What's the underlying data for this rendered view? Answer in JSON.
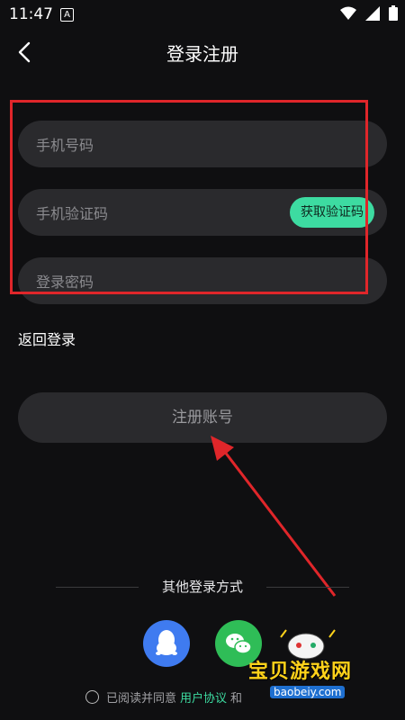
{
  "status_bar": {
    "time": "11:47",
    "notif_letter": "A"
  },
  "header": {
    "title": "登录注册"
  },
  "form": {
    "phone_placeholder": "手机号码",
    "code_placeholder": "手机验证码",
    "code_button": "获取验证码",
    "password_placeholder": "登录密码"
  },
  "back_login": "返回登录",
  "register_button": "注册账号",
  "other_login": {
    "label": "其他登录方式"
  },
  "agreement": {
    "prefix": "已阅读并同意",
    "link1": "用户协议",
    "and": "和"
  },
  "watermark": {
    "text": "宝贝游戏网",
    "url": "baobeiy.com"
  },
  "colors": {
    "accent": "#3ddba1",
    "highlight": "#e0262a",
    "qq": "#3f7bf0",
    "wechat": "#2fbd57"
  }
}
